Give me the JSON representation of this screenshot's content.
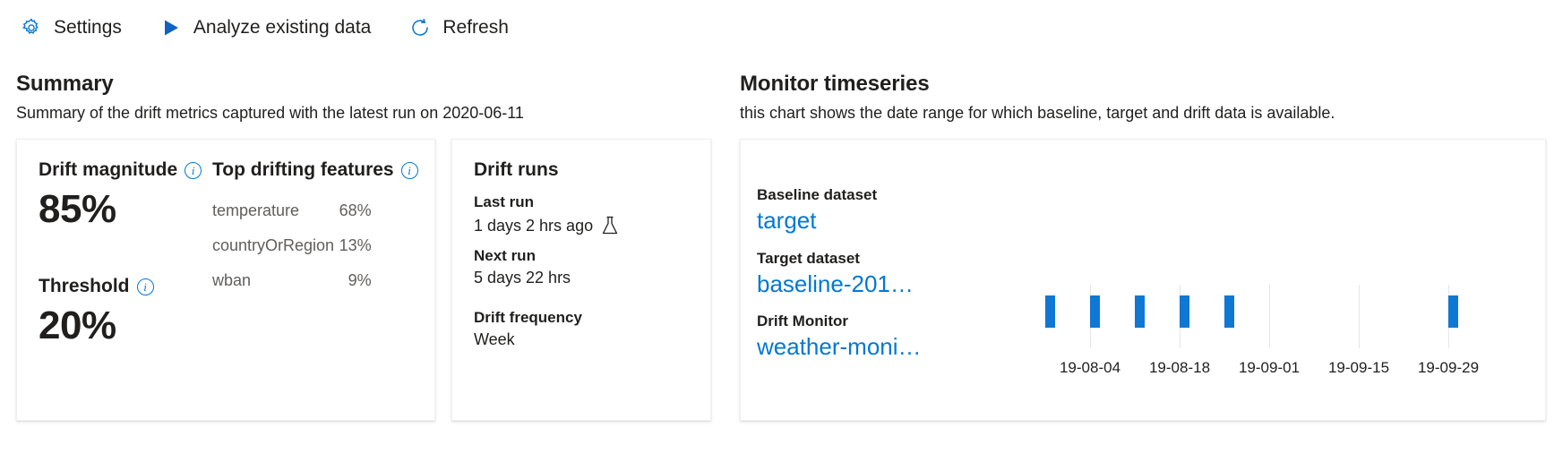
{
  "commandbar": {
    "items": [
      {
        "label": "Settings",
        "icon": "gear-icon",
        "name": "settings"
      },
      {
        "label": "Analyze existing data",
        "icon": "play-icon",
        "name": "analyze-existing-data"
      },
      {
        "label": "Refresh",
        "icon": "refresh-icon",
        "name": "refresh"
      }
    ]
  },
  "summary": {
    "title": "Summary",
    "subtitle": "Summary of the drift metrics captured with the latest run on 2020-06-11",
    "drift_magnitude": {
      "label": "Drift magnitude",
      "value": "85%",
      "info_glyph": "i"
    },
    "threshold": {
      "label": "Threshold",
      "value": "20%",
      "info_glyph": "i"
    },
    "top_drifting_features": {
      "label": "Top drifting features",
      "info_glyph": "i",
      "rows": [
        {
          "feature": "temperature",
          "percent": "68%"
        },
        {
          "feature": "countryOrRegion",
          "percent": "13%"
        },
        {
          "feature": "wban",
          "percent": "9%"
        }
      ]
    }
  },
  "drift_runs": {
    "title": "Drift runs",
    "last_run_label": "Last run",
    "last_run_value": "1 days 2 hrs ago",
    "last_run_icon": "flask-icon",
    "next_run_label": "Next run",
    "next_run_value": "5 days 22 hrs",
    "frequency_label": "Drift frequency",
    "frequency_value": "Week"
  },
  "monitor_timeseries": {
    "title": "Monitor timeseries",
    "subtitle": "this chart shows the date range for which baseline, target and drift data is available.",
    "baseline_label": "Baseline dataset",
    "baseline_value": "target",
    "target_label": "Target dataset",
    "target_value": "baseline-201…",
    "monitor_label": "Drift Monitor",
    "monitor_value": "weather-moni…"
  },
  "chart_data": {
    "type": "bar",
    "title": "Monitor timeseries",
    "xlabel": "",
    "ylabel": "",
    "grid": true,
    "legend": "none",
    "series": [
      {
        "name": "Drift Monitor",
        "color": "#0f77d4",
        "points": [
          {
            "x": "19-07-28",
            "value": 1
          },
          {
            "x": "19-08-04",
            "value": 1
          },
          {
            "x": "19-08-11",
            "value": 1
          },
          {
            "x": "19-08-18",
            "value": 1
          },
          {
            "x": "19-08-25",
            "value": 1
          },
          {
            "x": "19-09-29",
            "value": 1
          }
        ]
      }
    ],
    "tick_labels": [
      "19-08-04",
      "19-08-18",
      "19-09-01",
      "19-09-15",
      "19-09-29"
    ]
  },
  "colors": {
    "accent": "#0078d4",
    "bar": "#0f77d4",
    "text": "#201f1e",
    "muted": "#605e5c"
  }
}
